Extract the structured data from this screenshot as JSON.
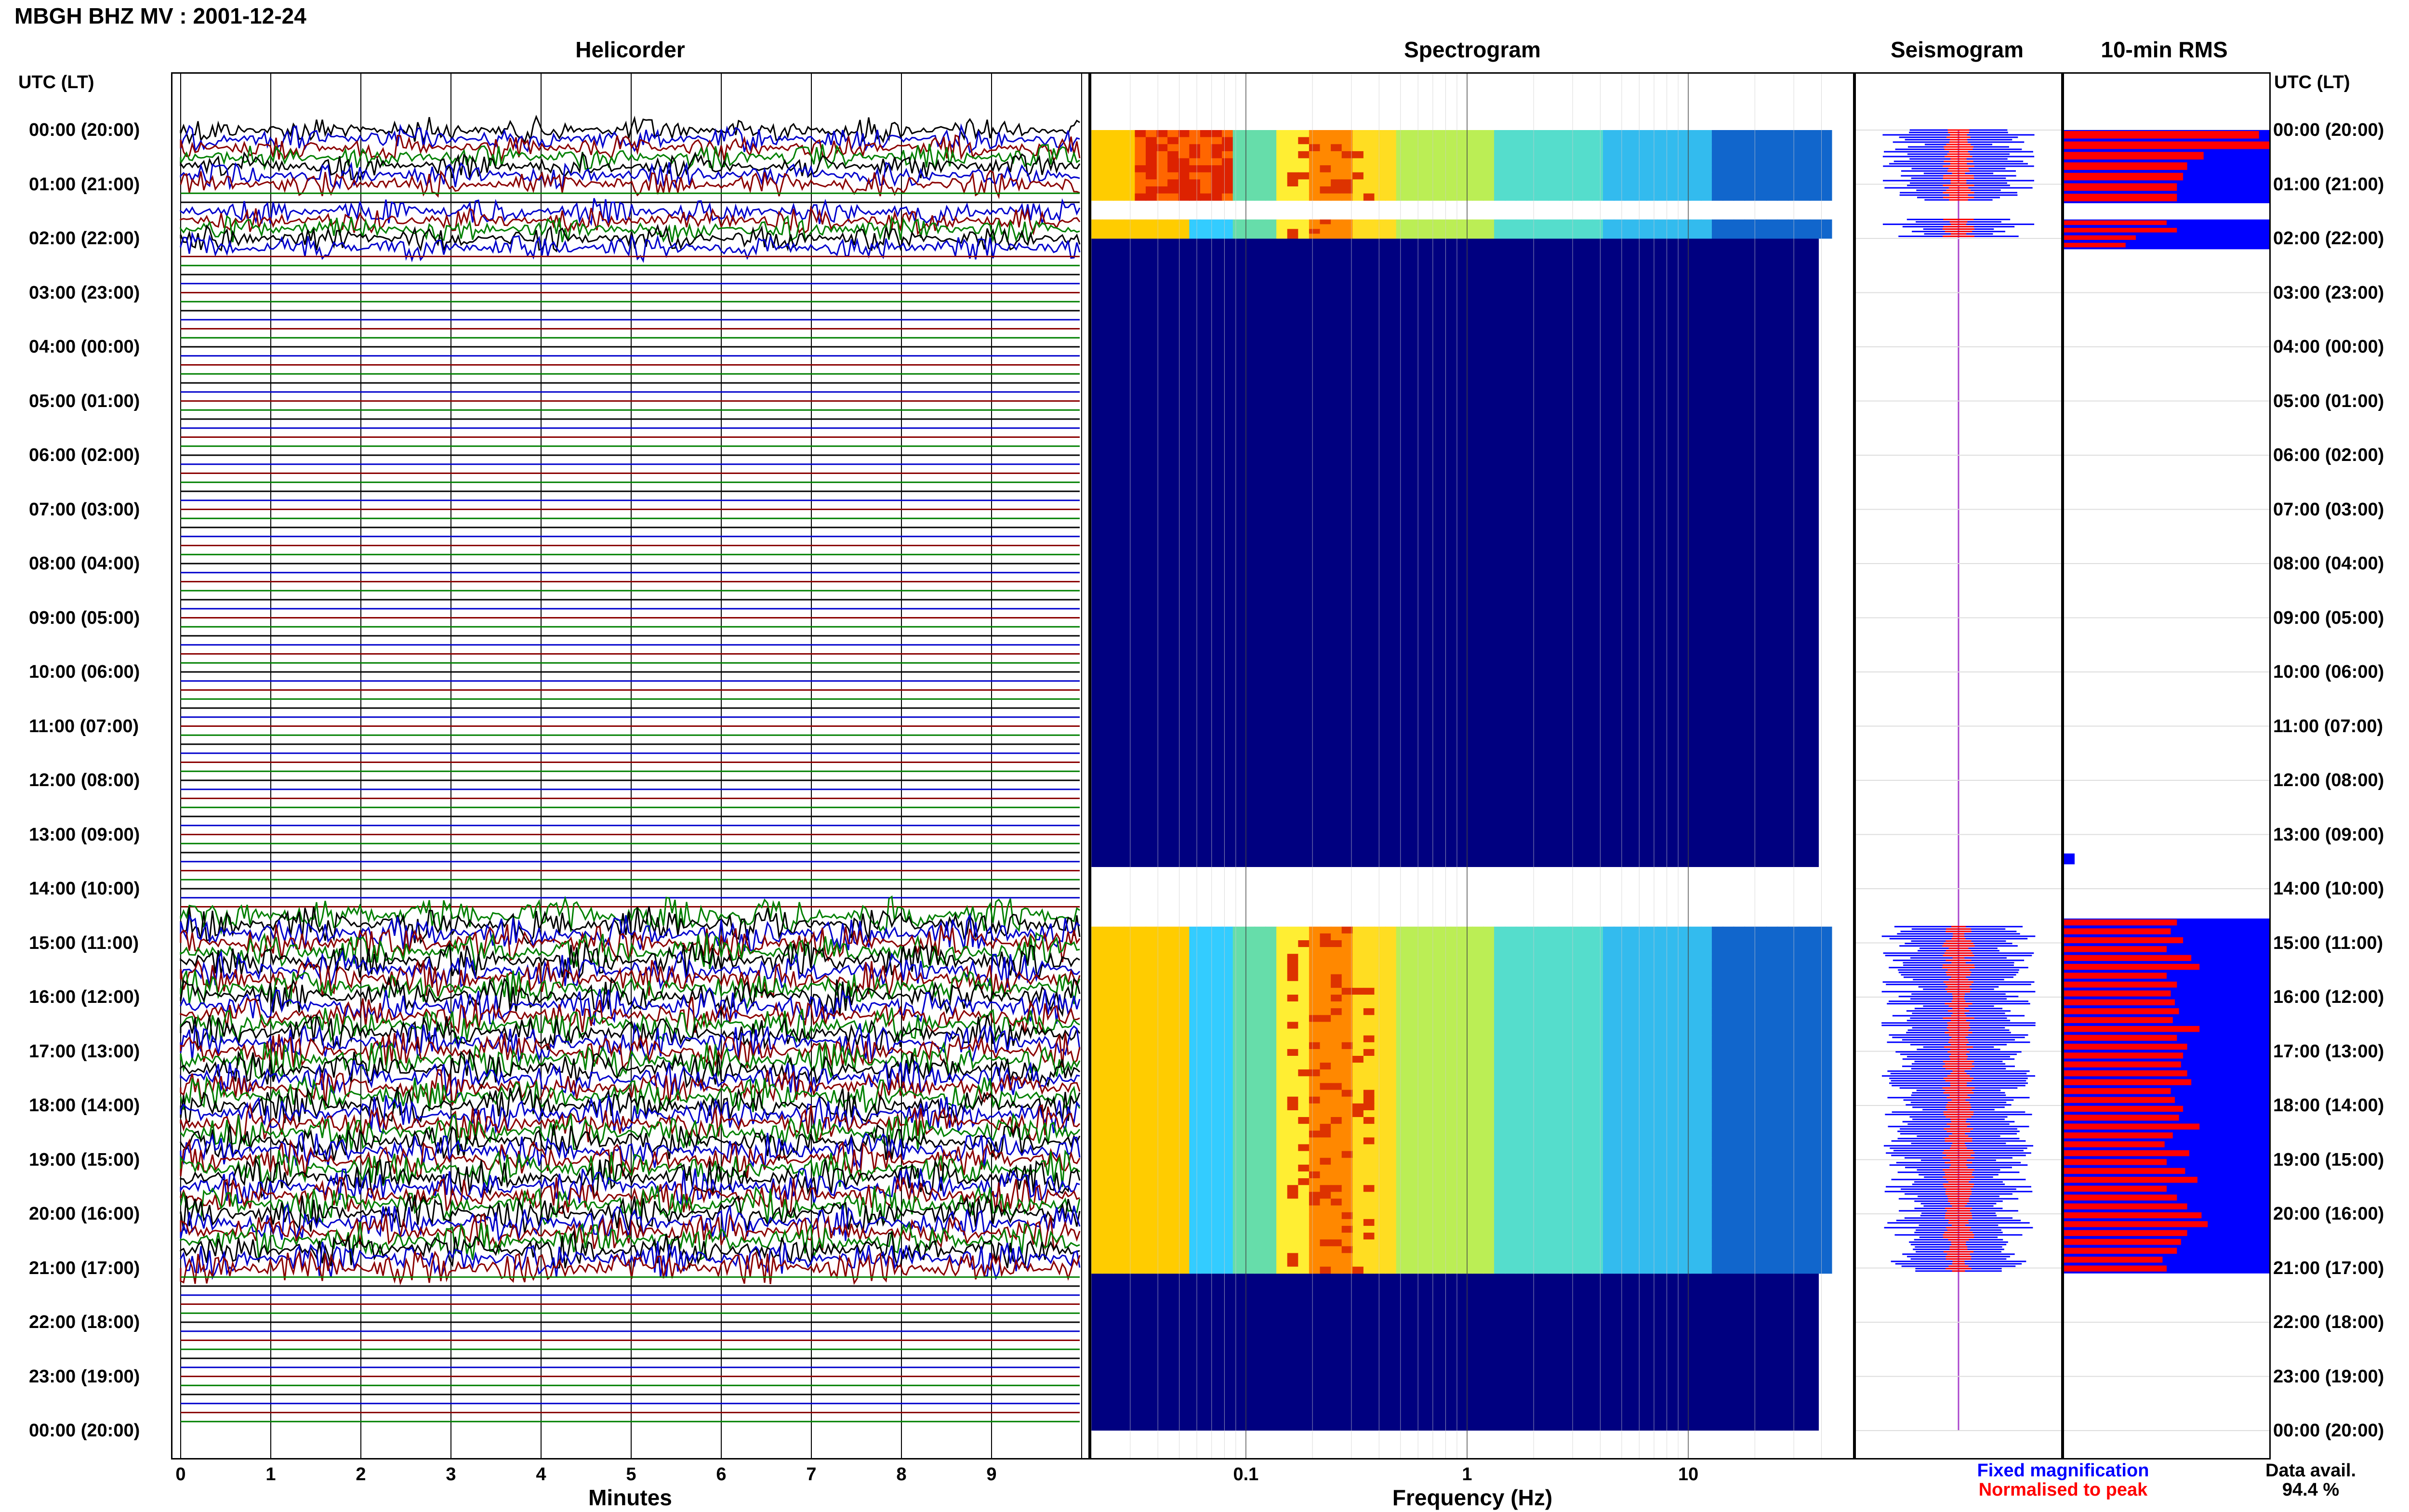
{
  "header": {
    "title": "MBGH BHZ MV : 2001-12-24"
  },
  "panels": {
    "helicorder": "Helicorder",
    "spectrogram": "Spectrogram",
    "seismogram": "Seismogram",
    "rms": "10-min RMS"
  },
  "axis": {
    "utc_lt_left": "UTC (LT)",
    "utc_lt_right": "UTC (LT)",
    "minutes_label": "Minutes",
    "frequency_label": "Frequency (Hz)"
  },
  "time_labels": [
    "00:00 (20:00)",
    "01:00 (21:00)",
    "02:00 (22:00)",
    "03:00 (23:00)",
    "04:00 (00:00)",
    "05:00 (01:00)",
    "06:00 (02:00)",
    "07:00 (03:00)",
    "08:00 (04:00)",
    "09:00 (05:00)",
    "10:00 (06:00)",
    "11:00 (07:00)",
    "12:00 (08:00)",
    "13:00 (09:00)",
    "14:00 (10:00)",
    "15:00 (11:00)",
    "16:00 (12:00)",
    "17:00 (13:00)",
    "18:00 (14:00)",
    "19:00 (15:00)",
    "20:00 (16:00)",
    "21:00 (17:00)",
    "22:00 (18:00)",
    "23:00 (19:00)",
    "00:00 (20:00)"
  ],
  "legend": {
    "fixed": "Fixed magnification",
    "normalised": "Normalised to peak",
    "data_avail_label": "Data avail.",
    "data_avail_value": "94.4 %",
    "fixed_color": "#0000ff",
    "normalised_color": "#ff0000"
  },
  "chart_data": [
    {
      "type": "line",
      "name": "helicorder",
      "xlabel": "Minutes",
      "x_ticks": [
        "0",
        "1",
        "2",
        "3",
        "4",
        "5",
        "6",
        "7",
        "8",
        "9"
      ],
      "xlim": [
        0,
        10
      ],
      "trace_colors": [
        "#000000",
        "#0000cc",
        "#8b0000",
        "#008000"
      ],
      "data_segments_hours": [
        [
          0,
          2.2
        ],
        [
          14.4,
          21.1
        ]
      ],
      "gap_hours": [
        [
          1.15,
          1.35
        ],
        [
          2.2,
          14.4
        ],
        [
          21.1,
          24
        ]
      ]
    },
    {
      "type": "heatmap",
      "name": "spectrogram",
      "xlabel": "Frequency (Hz)",
      "x_scale": "log",
      "x_ticks": [
        "0.1",
        "1",
        "10"
      ],
      "xlim": [
        0.02,
        50
      ],
      "data_segments_hours": [
        [
          0,
          1.3
        ],
        [
          1.65,
          2.0
        ],
        [
          14.7,
          21.1
        ]
      ],
      "no_data_color": "#000080"
    },
    {
      "type": "bar",
      "name": "10-min RMS",
      "orientation": "horizontal",
      "series": [
        {
          "name": "Fixed magnification",
          "color": "#0000ff"
        },
        {
          "name": "Normalised to peak",
          "color": "#ff0000"
        }
      ],
      "normalised_segment1": [
        0.95,
        1.0,
        0.68,
        0.6,
        0.58,
        0.55,
        0.55
      ],
      "normalised_segment2": [
        0.5,
        0.55,
        0.35,
        0.3
      ],
      "normalised_segment3": [
        0.05
      ],
      "normalised_segment4": [
        0.55,
        0.52,
        0.58,
        0.5,
        0.62,
        0.66,
        0.5,
        0.55,
        0.52,
        0.54,
        0.56,
        0.53,
        0.66,
        0.55,
        0.6,
        0.58,
        0.57,
        0.6,
        0.62,
        0.52,
        0.54,
        0.58,
        0.56,
        0.66,
        0.53,
        0.49,
        0.61,
        0.5,
        0.59,
        0.65,
        0.5,
        0.55,
        0.6,
        0.67,
        0.7,
        0.6,
        0.57,
        0.55,
        0.48,
        0.5
      ]
    }
  ]
}
